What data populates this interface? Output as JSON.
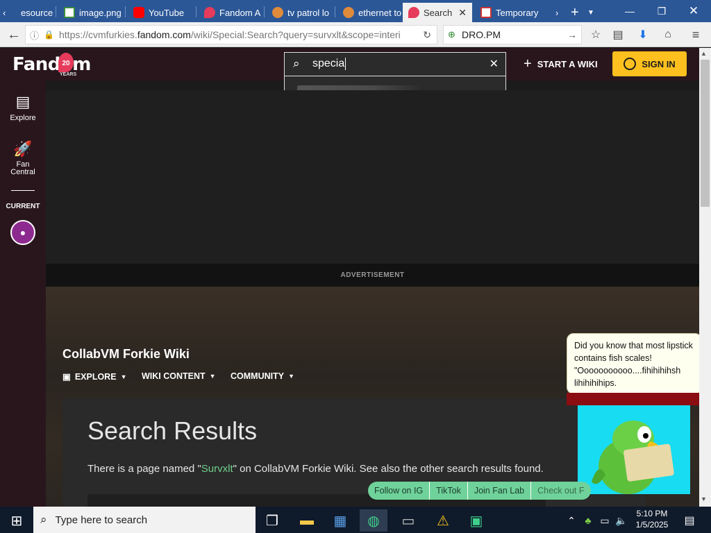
{
  "browser": {
    "tabs": [
      {
        "label": "esource H",
        "active": false
      },
      {
        "label": "image.png",
        "active": false
      },
      {
        "label": "YouTube",
        "active": false
      },
      {
        "label": "Fandom A",
        "active": false
      },
      {
        "label": "tv patrol lo",
        "active": false
      },
      {
        "label": "ethernet to",
        "active": false
      },
      {
        "label": "Search",
        "active": true
      },
      {
        "label": "Temporary",
        "active": false
      }
    ],
    "url_prefix": "https://cvmfurkies.",
    "url_domain": "fandom.com",
    "url_rest": "/wiki/Special:Search?query=survxlt&scope=interi",
    "search_engine_value": "DRO.PM"
  },
  "header": {
    "logo_text": "Fandom",
    "logo_badge": "20",
    "logo_years": "YEARS",
    "search_value": "specia",
    "start_wiki": "START A WIKI",
    "sign_in": "SIGN IN"
  },
  "rail": {
    "explore": "Explore",
    "fan_central_1": "Fan",
    "fan_central_2": "Central",
    "current": "CURRENT"
  },
  "main": {
    "advertisement": "ADVERTISEMENT",
    "wiki_name": "CollabVM Forkie Wiki",
    "nav": [
      "EXPLORE",
      "WIKI CONTENT",
      "COMMUNITY"
    ],
    "search_results_title": "Search Results",
    "result_prefix": "There is a page named \"",
    "result_link": "Survxlt",
    "result_suffix": "\" on CollabVM Forkie Wiki. See also the other search results found."
  },
  "bubble": {
    "text": "Did you know that most lipstick contains fish scales! \"Ooooooooooo....fihihihihsh lihihihihips."
  },
  "pills": [
    "Follow on IG",
    "TikTok",
    "Join Fan Lab",
    "Check out F"
  ],
  "taskbar": {
    "search_placeholder": "Type here to search",
    "time": "5:10 PM",
    "date": "1/5/2025"
  },
  "colors": {
    "tabbar": "#2b5797",
    "fandom_header": "#29161d",
    "sign_in": "#fdc01e",
    "link_green": "#6fd08b",
    "pills_green": "#6fd29a"
  }
}
